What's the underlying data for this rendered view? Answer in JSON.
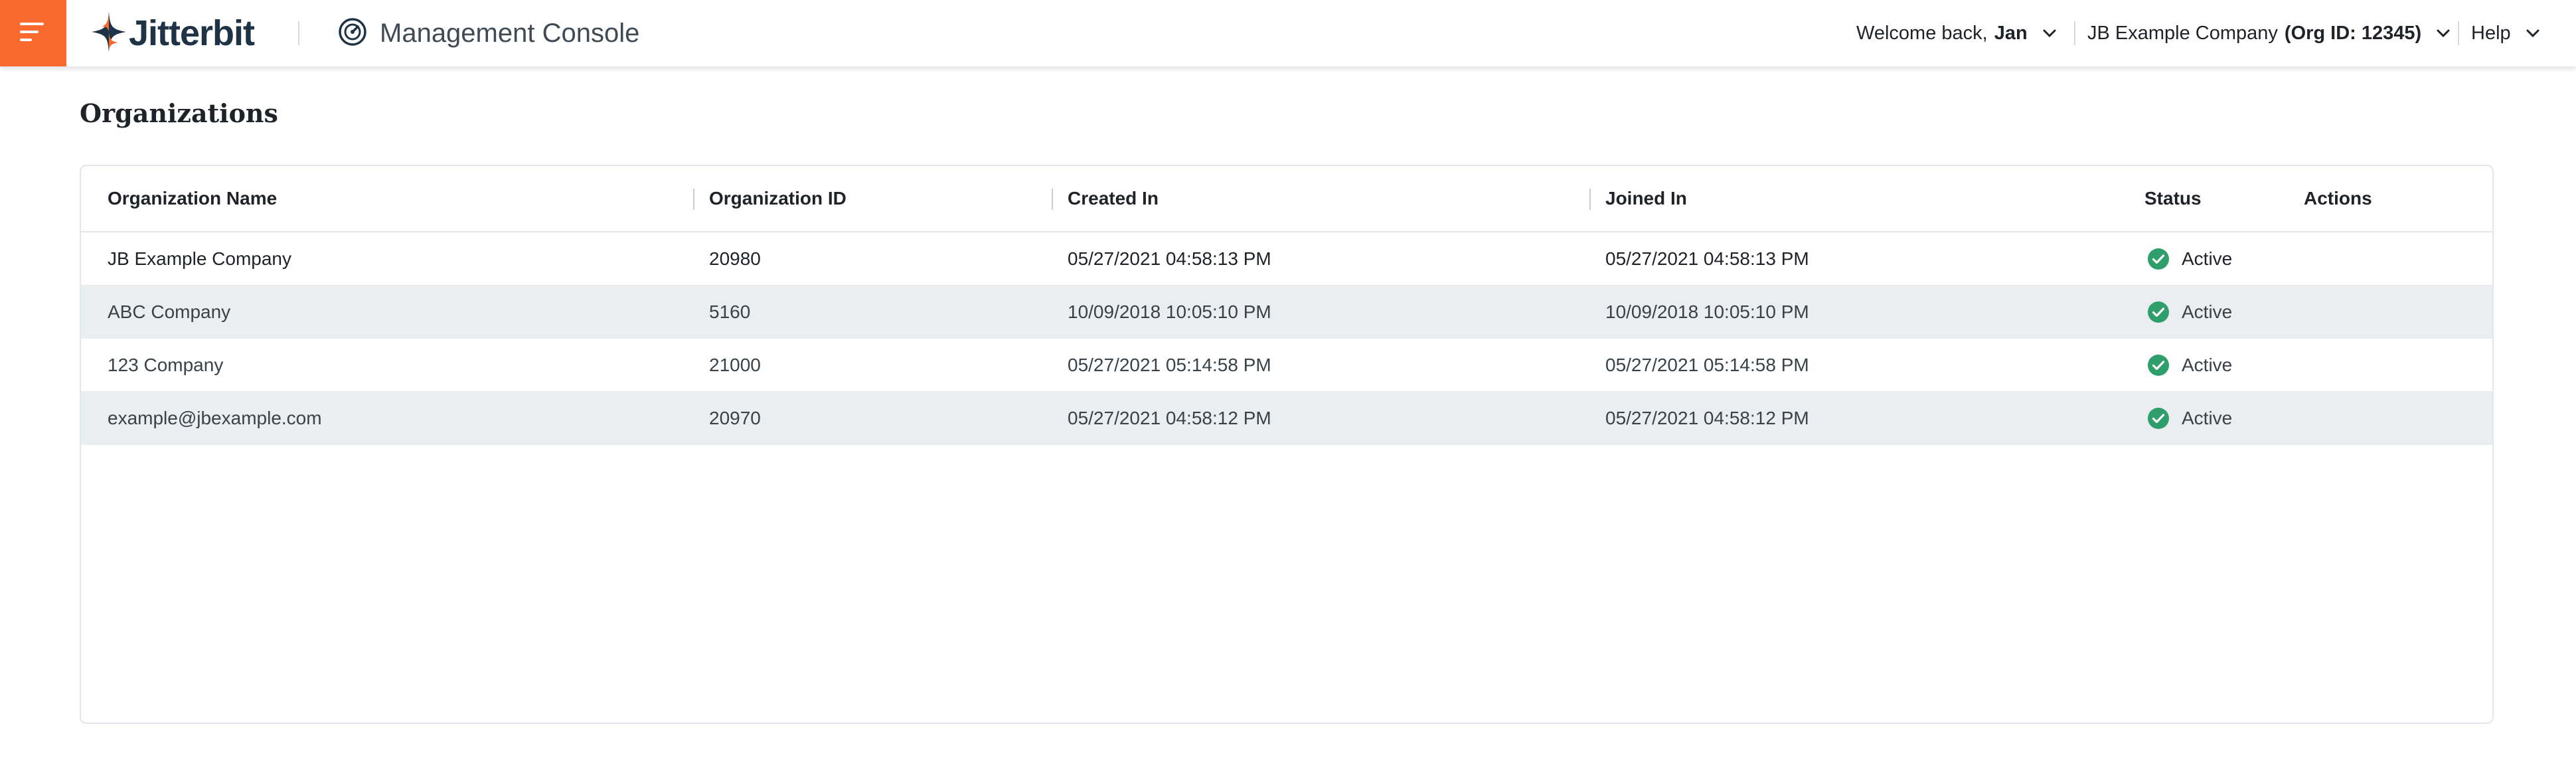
{
  "header": {
    "app_name": "Jitterbit",
    "section_title": "Management Console",
    "welcome_prefix": "Welcome back,",
    "user_name": "Jan",
    "org_name": "JB Example Company",
    "org_id_label": "(Org ID: 12345)",
    "help_label": "Help"
  },
  "page": {
    "title": "Organizations"
  },
  "table": {
    "columns": [
      "Organization Name",
      "Organization ID",
      "Created In",
      "Joined In",
      "Status",
      "Actions"
    ],
    "rows": [
      {
        "name": "JB Example Company",
        "id": "20980",
        "created": "05/27/2021 04:58:13 PM",
        "joined": "05/27/2021 04:58:13 PM",
        "status": "Active"
      },
      {
        "name": "ABC Company",
        "id": "5160",
        "created": "10/09/2018 10:05:10 PM",
        "joined": "10/09/2018 10:05:10 PM",
        "status": "Active"
      },
      {
        "name": "123 Company",
        "id": "21000",
        "created": "05/27/2021 05:14:58 PM",
        "joined": "05/27/2021 05:14:58 PM",
        "status": "Active"
      },
      {
        "name": "example@jbexample.com",
        "id": "20970",
        "created": "05/27/2021 04:58:12 PM",
        "joined": "05/27/2021 04:58:12 PM",
        "status": "Active"
      }
    ]
  },
  "icons": {
    "menu": "hamburger-menu-icon",
    "logo": "jitterbit-star-logo",
    "console": "dashboard-gauge-icon",
    "chevron": "chevron-down-icon",
    "status": "check-circle-icon"
  },
  "colors": {
    "accent": "#fa6a2e",
    "brand_navy": "#1f3347",
    "status_active": "#2e9e6b",
    "row_alt": "#eaeef1"
  }
}
